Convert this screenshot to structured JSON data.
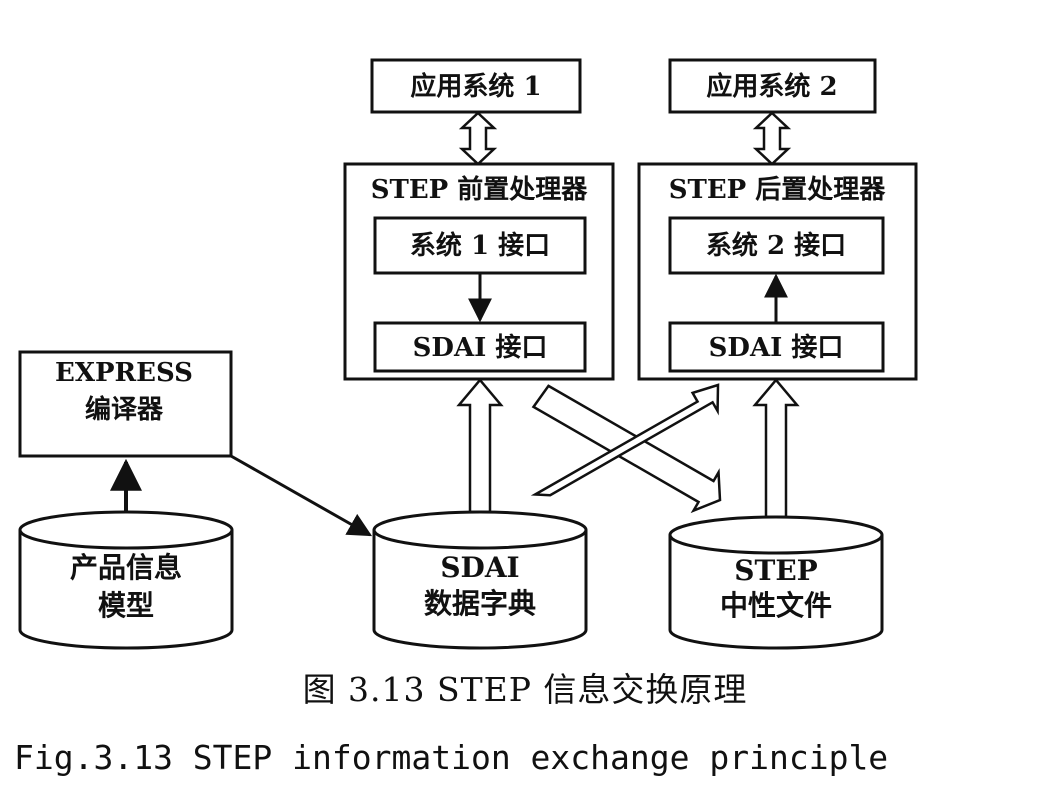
{
  "boxes": {
    "app1": "应用系统 1",
    "app2": "应用系统 2",
    "pre_processor": "STEP 前置处理器",
    "post_processor": "STEP 后置处理器",
    "sys1_interface": "系统 1 接口",
    "sys2_interface": "系统 2 接口",
    "sdai_interface_left": "SDAI 接口",
    "sdai_interface_right": "SDAI 接口",
    "express_line1": "EXPRESS",
    "express_line2": "编译器"
  },
  "databases": {
    "product_model_line1": "产品信息",
    "product_model_line2": "模型",
    "sdai_dict_line1": "SDAI",
    "sdai_dict_line2": "数据字典",
    "step_file_line1": "STEP",
    "step_file_line2": "中性文件"
  },
  "caption": {
    "chinese": "图 3.13   STEP 信息交换原理",
    "english": "Fig.3.13 STEP information exchange principle"
  }
}
